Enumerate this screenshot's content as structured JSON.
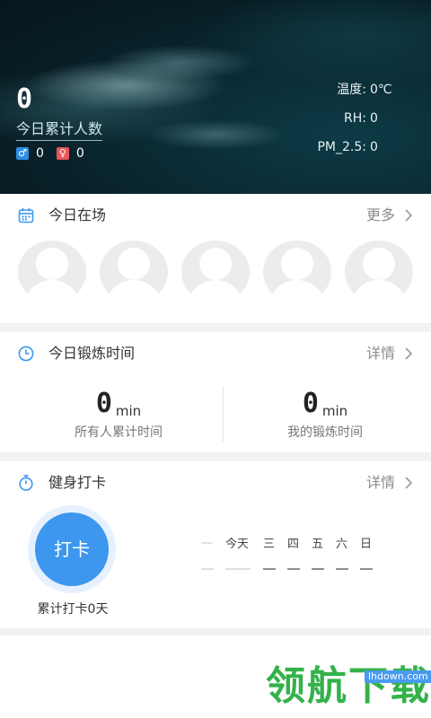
{
  "hero": {
    "total_count": "0",
    "total_label": "今日累计人数",
    "male_count": "0",
    "female_count": "0",
    "stats": [
      {
        "label": "温度:",
        "value": "0℃"
      },
      {
        "label": "RH:",
        "value": "0"
      },
      {
        "label": "PM_2.5:",
        "value": "0"
      }
    ]
  },
  "today_present": {
    "title": "今日在场",
    "more_label": "更多"
  },
  "exercise": {
    "title": "今日锻炼时间",
    "detail_label": "详情",
    "all_value": "0",
    "all_unit": "min",
    "all_desc": "所有人累计时间",
    "mine_value": "0",
    "mine_unit": "min",
    "mine_desc": "我的锻炼时间"
  },
  "checkin": {
    "title": "健身打卡",
    "detail_label": "详情",
    "button_label": "打卡",
    "total_label": "累计打卡0天",
    "weekdays": [
      "一",
      "今天",
      "三",
      "四",
      "五",
      "六",
      "日"
    ]
  },
  "watermark": {
    "text": "领航下载",
    "url": "lhdown.com"
  },
  "icons": {
    "calendar": "calendar-icon",
    "clock": "clock-icon",
    "stopwatch": "stopwatch-icon",
    "chevron": "chevron-right-icon"
  },
  "colors": {
    "accent": "#3d97ee",
    "section_bg": "#f1f2f4"
  }
}
